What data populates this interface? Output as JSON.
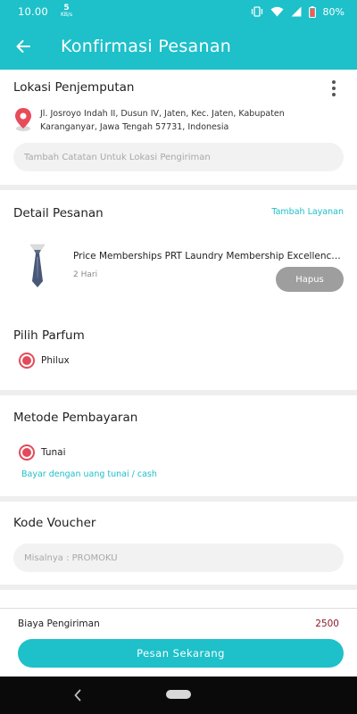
{
  "status_bar": {
    "time": "10.00",
    "speed_value": "5",
    "speed_unit": "KB/s",
    "battery": "80%"
  },
  "header": {
    "title": "Konfirmasi Pesanan",
    "back_icon": "arrow-left-icon"
  },
  "pickup": {
    "title": "Lokasi Penjemputan",
    "address": "Jl. Josroyo Indah II, Dusun IV, Jaten, Kec. Jaten, Kabupaten Karanganyar, Jawa Tengah 57731, Indonesia",
    "note_placeholder": "Tambah Catatan Untuk Lokasi Pengiriman"
  },
  "order_detail": {
    "title": "Detail Pesanan",
    "add_service": "Tambah Layanan",
    "item": {
      "name": "Price Memberships PRT Laundry  Membership Excellence (VVIP)",
      "duration": "2 Hari",
      "remove_label": "Hapus"
    },
    "perfume_title": "Pilih Parfum",
    "perfume_selected": "Philux"
  },
  "payment": {
    "title": "Metode Pembayaran",
    "selected": "Tunai",
    "hint": "Bayar dengan uang tunai / cash"
  },
  "voucher": {
    "title": "Kode Voucher",
    "placeholder": "Misalnya : PROMOKU"
  },
  "footer": {
    "shipping_label": "Biaya Pengiriman",
    "shipping_value": "2500",
    "order_button": "Pesan Sekarang"
  },
  "colors": {
    "accent": "#1ec0c9",
    "radio": "#e34b5a",
    "price": "#8b1a2a"
  }
}
